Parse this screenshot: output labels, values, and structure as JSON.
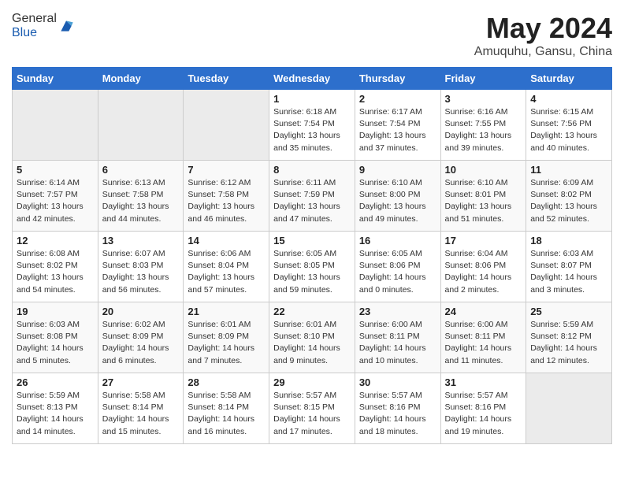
{
  "header": {
    "logo_general": "General",
    "logo_blue": "Blue",
    "month_year": "May 2024",
    "location": "Amuquhu, Gansu, China"
  },
  "days_of_week": [
    "Sunday",
    "Monday",
    "Tuesday",
    "Wednesday",
    "Thursday",
    "Friday",
    "Saturday"
  ],
  "weeks": [
    {
      "days": [
        {
          "number": null,
          "empty": true
        },
        {
          "number": null,
          "empty": true
        },
        {
          "number": null,
          "empty": true
        },
        {
          "number": "1",
          "sunrise": "6:18 AM",
          "sunset": "7:54 PM",
          "daylight": "13 hours and 35 minutes."
        },
        {
          "number": "2",
          "sunrise": "6:17 AM",
          "sunset": "7:54 PM",
          "daylight": "13 hours and 37 minutes."
        },
        {
          "number": "3",
          "sunrise": "6:16 AM",
          "sunset": "7:55 PM",
          "daylight": "13 hours and 39 minutes."
        },
        {
          "number": "4",
          "sunrise": "6:15 AM",
          "sunset": "7:56 PM",
          "daylight": "13 hours and 40 minutes."
        }
      ]
    },
    {
      "days": [
        {
          "number": "5",
          "sunrise": "6:14 AM",
          "sunset": "7:57 PM",
          "daylight": "13 hours and 42 minutes."
        },
        {
          "number": "6",
          "sunrise": "6:13 AM",
          "sunset": "7:58 PM",
          "daylight": "13 hours and 44 minutes."
        },
        {
          "number": "7",
          "sunrise": "6:12 AM",
          "sunset": "7:58 PM",
          "daylight": "13 hours and 46 minutes."
        },
        {
          "number": "8",
          "sunrise": "6:11 AM",
          "sunset": "7:59 PM",
          "daylight": "13 hours and 47 minutes."
        },
        {
          "number": "9",
          "sunrise": "6:10 AM",
          "sunset": "8:00 PM",
          "daylight": "13 hours and 49 minutes."
        },
        {
          "number": "10",
          "sunrise": "6:10 AM",
          "sunset": "8:01 PM",
          "daylight": "13 hours and 51 minutes."
        },
        {
          "number": "11",
          "sunrise": "6:09 AM",
          "sunset": "8:02 PM",
          "daylight": "13 hours and 52 minutes."
        }
      ]
    },
    {
      "days": [
        {
          "number": "12",
          "sunrise": "6:08 AM",
          "sunset": "8:02 PM",
          "daylight": "13 hours and 54 minutes."
        },
        {
          "number": "13",
          "sunrise": "6:07 AM",
          "sunset": "8:03 PM",
          "daylight": "13 hours and 56 minutes."
        },
        {
          "number": "14",
          "sunrise": "6:06 AM",
          "sunset": "8:04 PM",
          "daylight": "13 hours and 57 minutes."
        },
        {
          "number": "15",
          "sunrise": "6:05 AM",
          "sunset": "8:05 PM",
          "daylight": "13 hours and 59 minutes."
        },
        {
          "number": "16",
          "sunrise": "6:05 AM",
          "sunset": "8:06 PM",
          "daylight": "14 hours and 0 minutes."
        },
        {
          "number": "17",
          "sunrise": "6:04 AM",
          "sunset": "8:06 PM",
          "daylight": "14 hours and 2 minutes."
        },
        {
          "number": "18",
          "sunrise": "6:03 AM",
          "sunset": "8:07 PM",
          "daylight": "14 hours and 3 minutes."
        }
      ]
    },
    {
      "days": [
        {
          "number": "19",
          "sunrise": "6:03 AM",
          "sunset": "8:08 PM",
          "daylight": "14 hours and 5 minutes."
        },
        {
          "number": "20",
          "sunrise": "6:02 AM",
          "sunset": "8:09 PM",
          "daylight": "14 hours and 6 minutes."
        },
        {
          "number": "21",
          "sunrise": "6:01 AM",
          "sunset": "8:09 PM",
          "daylight": "14 hours and 7 minutes."
        },
        {
          "number": "22",
          "sunrise": "6:01 AM",
          "sunset": "8:10 PM",
          "daylight": "14 hours and 9 minutes."
        },
        {
          "number": "23",
          "sunrise": "6:00 AM",
          "sunset": "8:11 PM",
          "daylight": "14 hours and 10 minutes."
        },
        {
          "number": "24",
          "sunrise": "6:00 AM",
          "sunset": "8:11 PM",
          "daylight": "14 hours and 11 minutes."
        },
        {
          "number": "25",
          "sunrise": "5:59 AM",
          "sunset": "8:12 PM",
          "daylight": "14 hours and 12 minutes."
        }
      ]
    },
    {
      "days": [
        {
          "number": "26",
          "sunrise": "5:59 AM",
          "sunset": "8:13 PM",
          "daylight": "14 hours and 14 minutes."
        },
        {
          "number": "27",
          "sunrise": "5:58 AM",
          "sunset": "8:14 PM",
          "daylight": "14 hours and 15 minutes."
        },
        {
          "number": "28",
          "sunrise": "5:58 AM",
          "sunset": "8:14 PM",
          "daylight": "14 hours and 16 minutes."
        },
        {
          "number": "29",
          "sunrise": "5:57 AM",
          "sunset": "8:15 PM",
          "daylight": "14 hours and 17 minutes."
        },
        {
          "number": "30",
          "sunrise": "5:57 AM",
          "sunset": "8:16 PM",
          "daylight": "14 hours and 18 minutes."
        },
        {
          "number": "31",
          "sunrise": "5:57 AM",
          "sunset": "8:16 PM",
          "daylight": "14 hours and 19 minutes."
        },
        {
          "number": null,
          "empty": true
        }
      ]
    }
  ]
}
